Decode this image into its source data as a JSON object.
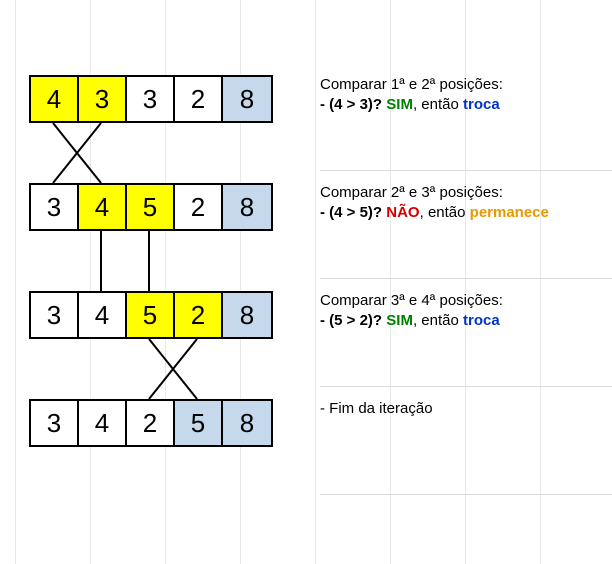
{
  "colors": {
    "highlight": "#ffff00",
    "sorted": "#c6d9ec",
    "grid": "#e9e9e9",
    "sim": "#008000",
    "nao": "#d40000",
    "troca": "#0033cc",
    "perm": "#e69900"
  },
  "rows": [
    {
      "values": [
        "4",
        "3",
        "3",
        "2",
        "8"
      ],
      "highlight": [
        0,
        1
      ],
      "sorted": [
        4
      ]
    },
    {
      "values": [
        "3",
        "4",
        "5",
        "2",
        "8"
      ],
      "highlight": [
        1,
        2
      ],
      "sorted": [
        4
      ]
    },
    {
      "values": [
        "3",
        "4",
        "5",
        "2",
        "8"
      ],
      "highlight": [
        2,
        3
      ],
      "sorted": [
        4
      ]
    },
    {
      "values": [
        "3",
        "4",
        "2",
        "5",
        "8"
      ],
      "highlight": [],
      "sorted": [
        3,
        4
      ]
    }
  ],
  "transitions": [
    {
      "type": "swap"
    },
    {
      "type": "stay"
    },
    {
      "type": "swap"
    }
  ],
  "captions": {
    "c0": {
      "title": "Comparar 1ª e 2ª posições:",
      "cmp": "- (4 > 3)? ",
      "res": "SIM",
      "mid": ", então ",
      "act": "troca"
    },
    "c1": {
      "title": "Comparar 2ª e 3ª posições:",
      "cmp": "- (4 > 5)? ",
      "res": "NÃO",
      "mid": ", então ",
      "act": "permanece"
    },
    "c2": {
      "title": "Comparar 3ª e 4ª posições:",
      "cmp": "- (5 > 2)? ",
      "res": "SIM",
      "mid": ", então ",
      "act": "troca"
    },
    "c3": {
      "title": "- Fim da iteração"
    }
  }
}
